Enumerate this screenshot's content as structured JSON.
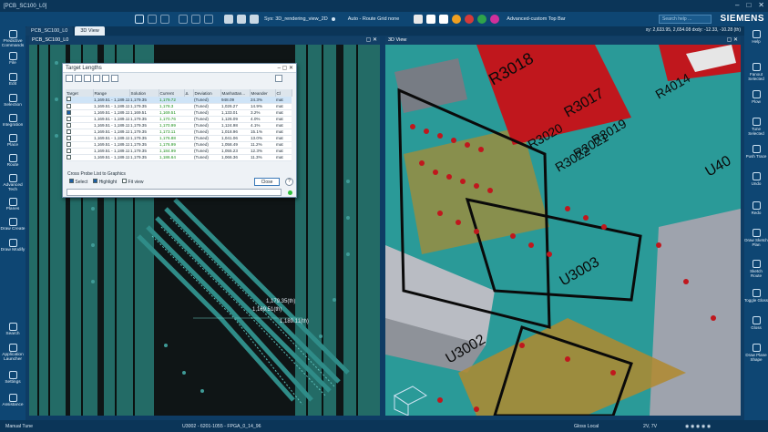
{
  "window": {
    "title": "[PCB_SC100_L0]"
  },
  "toolbar": {
    "view_select": "Sys: 3D_rendering_view_2D",
    "route_grid": "Auto - Route Grid none",
    "top_bar": "Advanced-custom Top Bar",
    "search_placeholder": "Search help ...",
    "brand": "SIEMENS"
  },
  "tabs": [
    {
      "label": "PCB_SC100_L0"
    },
    {
      "label": "3D View"
    }
  ],
  "coords": "xy: 2,633.95, 2,654.08  dxdy: -12.33, -10.28  (th)",
  "panes": {
    "left_title": "PCB_SC100_L0",
    "right_title": "3D View"
  },
  "left_sidebar": [
    {
      "label": "Predictive Commands",
      "icon": "predictive-icon"
    },
    {
      "label": "File",
      "icon": "file-icon"
    },
    {
      "label": "Edit",
      "icon": "edit-icon"
    },
    {
      "label": "Selection",
      "icon": "selection-icon"
    },
    {
      "label": "Integration",
      "icon": "integration-icon"
    },
    {
      "label": "Place",
      "icon": "place-icon"
    },
    {
      "label": "Route",
      "icon": "route-icon"
    },
    {
      "label": "Advanced Tech",
      "icon": "advanced-tech-icon"
    },
    {
      "label": "Planes",
      "icon": "planes-icon"
    },
    {
      "label": "Draw Create",
      "icon": "draw-create-icon"
    },
    {
      "label": "Draw Modify",
      "icon": "draw-modify-icon"
    },
    {
      "label": "Search",
      "icon": "search-icon"
    },
    {
      "label": "Application Launcher",
      "icon": "app-launcher-icon"
    },
    {
      "label": "Settings",
      "icon": "settings-icon"
    },
    {
      "label": "Assistance",
      "icon": "assistance-icon"
    }
  ],
  "right_sidebar": [
    {
      "label": "Help",
      "icon": "help-icon"
    },
    {
      "label": "Fanout Selected",
      "icon": "fanout-icon"
    },
    {
      "label": "Plow",
      "icon": "plow-icon"
    },
    {
      "label": "Tune Selected",
      "icon": "tune-icon"
    },
    {
      "label": "Push Trace",
      "icon": "push-trace-icon"
    },
    {
      "label": "Undo",
      "icon": "undo-icon"
    },
    {
      "label": "Redo",
      "icon": "redo-icon"
    },
    {
      "label": "Draw Sketch Plan",
      "icon": "sketch-plan-icon"
    },
    {
      "label": "Sketch Route",
      "icon": "sketch-route-icon"
    },
    {
      "label": "Toggle Gloss",
      "icon": "toggle-gloss-icon"
    },
    {
      "label": "Gloss",
      "icon": "gloss-icon"
    },
    {
      "label": "Draw Plane Shape",
      "icon": "plane-shape-icon"
    }
  ],
  "dialog": {
    "title": "Target Lengths",
    "columns": [
      "Target",
      "Range",
      "Solution",
      "Current",
      "Δ",
      "Deviation",
      "Manhattan...",
      "Meander",
      "Cl"
    ],
    "rows": [
      {
        "target": false,
        "range": "1,169.51 - 1,189.11",
        "solution": "1,179.35",
        "current": "1,179.72",
        "deviation": "(Tuned)",
        "manhattan": "948.09",
        "meander": "24.3%",
        "cl": "mat"
      },
      {
        "target": false,
        "range": "1,169.51 - 1,189.11",
        "solution": "1,179.35",
        "current": "1,178.3",
        "deviation": "(Tuned)",
        "manhattan": "1,026.27",
        "meander": "14.9%",
        "cl": "mat"
      },
      {
        "target": true,
        "range": "1,169.51 - 1,189.11",
        "solution": "1,169.51",
        "current": "1,169.51",
        "deviation": "(Tuned)",
        "manhattan": "1,133.01",
        "meander": "3.2%",
        "cl": "mat"
      },
      {
        "target": false,
        "range": "1,169.51 - 1,189.11",
        "solution": "1,179.35",
        "current": "1,170.76",
        "deviation": "(Tuned)",
        "manhattan": "1,126.09",
        "meander": "4.0%",
        "cl": "mat"
      },
      {
        "target": false,
        "range": "1,169.51 - 1,189.11",
        "solution": "1,179.35",
        "current": "1,170.99",
        "deviation": "(Tuned)",
        "manhattan": "1,124.98",
        "meander": "4.1%",
        "cl": "mat"
      },
      {
        "target": false,
        "range": "1,169.51 - 1,189.11",
        "solution": "1,179.35",
        "current": "1,173.11",
        "deviation": "(Tuned)",
        "manhattan": "1,018.96",
        "meander": "15.1%",
        "cl": "mat"
      },
      {
        "target": false,
        "range": "1,169.51 - 1,189.11",
        "solution": "1,179.35",
        "current": "1,176.88",
        "deviation": "(Tuned)",
        "manhattan": "1,041.06",
        "meander": "13.0%",
        "cl": "mat"
      },
      {
        "target": false,
        "range": "1,169.51 - 1,189.11",
        "solution": "1,179.35",
        "current": "1,176.99",
        "deviation": "(Tuned)",
        "manhattan": "1,058.49",
        "meander": "11.2%",
        "cl": "mat"
      },
      {
        "target": false,
        "range": "1,169.51 - 1,189.11",
        "solution": "1,179.35",
        "current": "1,184.99",
        "deviation": "(Tuned)",
        "manhattan": "1,055.23",
        "meander": "12.3%",
        "cl": "mat"
      },
      {
        "target": false,
        "range": "1,169.51 - 1,189.11",
        "solution": "1,179.35",
        "current": "1,186.64",
        "deviation": "(Tuned)",
        "manhattan": "1,066.36",
        "meander": "11.3%",
        "cl": "mat"
      }
    ],
    "probe_label": "Cross Probe List to Graphics",
    "select_label": "Select",
    "highlight_label": "Highlight",
    "fit_label": "Fit view",
    "close_label": "Close"
  },
  "annotations": [
    "1,179.35(th)",
    "1,169.51(th)",
    "1,189.11(th)"
  ],
  "refdes": [
    "R3018",
    "R3017",
    "R3019",
    "R3020",
    "R3021",
    "R3022",
    "R4014",
    "U40",
    "U3003",
    "U3002"
  ],
  "status": {
    "mode": "Manual Tune",
    "net": "U3002 - 6201-1055 - FPGA_0_14_96",
    "gloss": "Gloss Local",
    "layer": "2V, 7V"
  },
  "colors": {
    "board": "#2a9a98",
    "copper_red": "#c0171d",
    "gold": "#b08a2e",
    "ui_blue": "#0e4673"
  }
}
